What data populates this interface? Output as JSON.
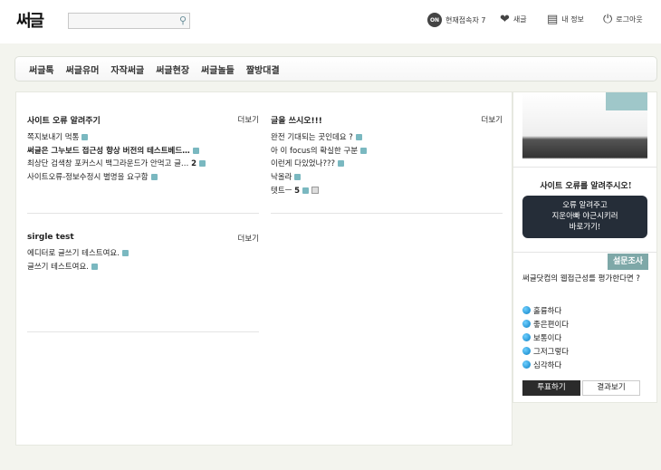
{
  "header": {
    "logo": "써글",
    "search_placeholder": "",
    "menu": [
      {
        "icon": "on-icon",
        "label": "현재접속자 7"
      },
      {
        "icon": "heart-icon",
        "label": "새글"
      },
      {
        "icon": "profile-icon",
        "label": "내 정보"
      },
      {
        "icon": "power-icon",
        "label": "로그아웃"
      }
    ],
    "on_badge": "ON"
  },
  "nav": [
    "써글톡",
    "써글유머",
    "자작써글",
    "써글현장",
    "써글놀들",
    "짤방대결"
  ],
  "sections": [
    {
      "title": "사이트 오류 알려주기",
      "more": "더보기",
      "items": [
        {
          "text": "쪽지보내기 먹통"
        },
        {
          "text": "써글은 그누보드 접근성 향상 버전의 테스트베드…",
          "bold": true
        },
        {
          "text": "최상단 검색창 포커스시 백그라운드가 안먹고 글…",
          "count": "2"
        },
        {
          "text": "사이트오류-정보수정시 별명을 요구함"
        }
      ]
    },
    {
      "title": "글을 쓰시오!!!",
      "more": "더보기",
      "items": [
        {
          "text": "완전 기대되는 곳인데요 ?"
        },
        {
          "text": "아 이 focus의 확실한 구분"
        },
        {
          "text": "이런게 다있었나???"
        },
        {
          "text": "낙올라"
        },
        {
          "text": "텟트ㅡ",
          "count": "5",
          "attachment": true
        }
      ]
    },
    {
      "title": "sirgle test",
      "more": "더보기",
      "items": [
        {
          "text": "에디터로 글쓰기 테스트여요."
        },
        {
          "text": "글쓰기 테스트여요."
        }
      ]
    }
  ],
  "sidebar": {
    "error_heading": "사이트 오류를 알려주시오!",
    "error_button": [
      "오류 알려주고",
      "지운아빠 야근시키러",
      "바로가기!"
    ],
    "poll_badge": "설문조사",
    "poll_question": "써글닷컴의 웹접근성를 평가한다면 ?",
    "poll_options": [
      "훌륭하다",
      "좋은편이다",
      "보통이다",
      "그저그렇다",
      "심각하다"
    ],
    "vote": "투표하기",
    "results": "결과보기"
  }
}
